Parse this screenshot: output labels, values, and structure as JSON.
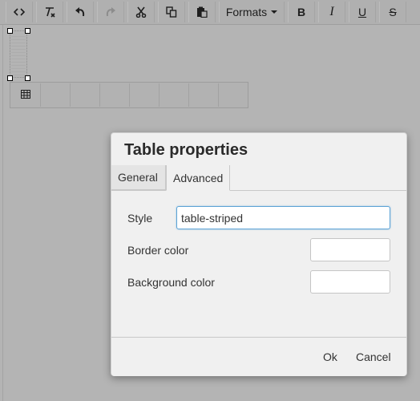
{
  "toolbar": {
    "items": [
      {
        "name": "source-code-icon"
      },
      {
        "name": "clear-formatting-icon"
      },
      {
        "name": "undo-icon"
      },
      {
        "name": "redo-icon"
      },
      {
        "name": "cut-icon"
      },
      {
        "name": "copy-icon"
      },
      {
        "name": "paste-icon"
      },
      {
        "name": "formats-dropdown",
        "label": "Formats"
      },
      {
        "name": "bold-icon",
        "label": "B"
      },
      {
        "name": "italic-icon",
        "label": "I"
      },
      {
        "name": "underline-icon",
        "label": "U"
      },
      {
        "name": "strikethrough-icon",
        "label": "S"
      }
    ]
  },
  "context_toolbar": {
    "icon": "table-icon"
  },
  "dialog": {
    "title": "Table properties",
    "tabs": [
      {
        "label": "General",
        "active": false
      },
      {
        "label": "Advanced",
        "active": true
      }
    ],
    "fields": {
      "style": {
        "label": "Style",
        "value": "table-striped"
      },
      "border_color": {
        "label": "Border color",
        "value": ""
      },
      "background_color": {
        "label": "Background color",
        "value": ""
      }
    },
    "buttons": {
      "ok": "Ok",
      "cancel": "Cancel"
    }
  },
  "colors": {
    "focus_border": "#5ca3d6",
    "overlay_gray": "#b4b4b4",
    "dialog_bg": "#f0f0f0"
  }
}
